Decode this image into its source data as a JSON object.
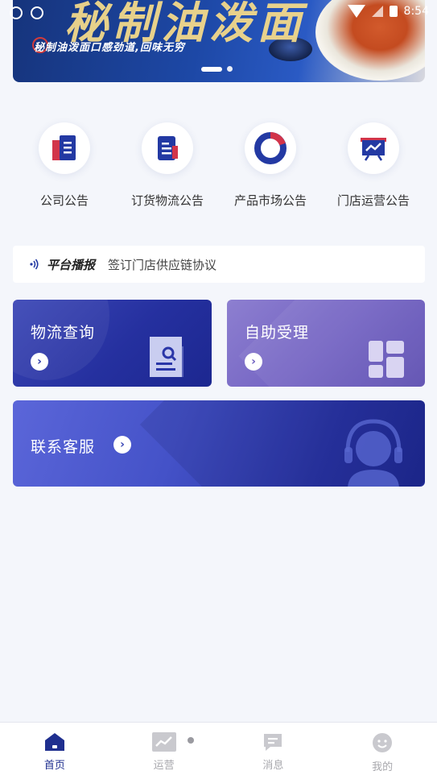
{
  "status_bar": {
    "time": "8:54"
  },
  "banner": {
    "headline": "秘制油泼面",
    "tagline": "秘制油泼面口感劲道,回味无穷",
    "slide_count": 2,
    "active_slide": 1
  },
  "quick_menu": [
    {
      "label": "公司公告",
      "icon": "building-doc-icon"
    },
    {
      "label": "订货物流公告",
      "icon": "document-icon"
    },
    {
      "label": "产品市场公告",
      "icon": "pie-chart-icon"
    },
    {
      "label": "门店运营公告",
      "icon": "presentation-chart-icon"
    }
  ],
  "broadcast": {
    "title": "平台播报",
    "text": "签订门店供应链协议"
  },
  "cards": {
    "logistics": {
      "title": "物流查询",
      "arrow": "›"
    },
    "self_service": {
      "title": "自助受理",
      "arrow": "›"
    },
    "contact": {
      "title": "联系客服",
      "arrow": "›"
    }
  },
  "tabbar": {
    "items": [
      {
        "label": "首页",
        "icon": "home-icon",
        "active": true
      },
      {
        "label": "运营",
        "icon": "chart-icon",
        "active": false
      },
      {
        "label": "消息",
        "icon": "message-icon",
        "active": false
      },
      {
        "label": "我的",
        "icon": "profile-icon",
        "active": false
      }
    ]
  },
  "colors": {
    "primary": "#1f2f8f",
    "logistics_card": "#25309f",
    "self_service_card": "#7262c2",
    "contact_card": "#4452c8",
    "background": "#f4f6fb"
  }
}
